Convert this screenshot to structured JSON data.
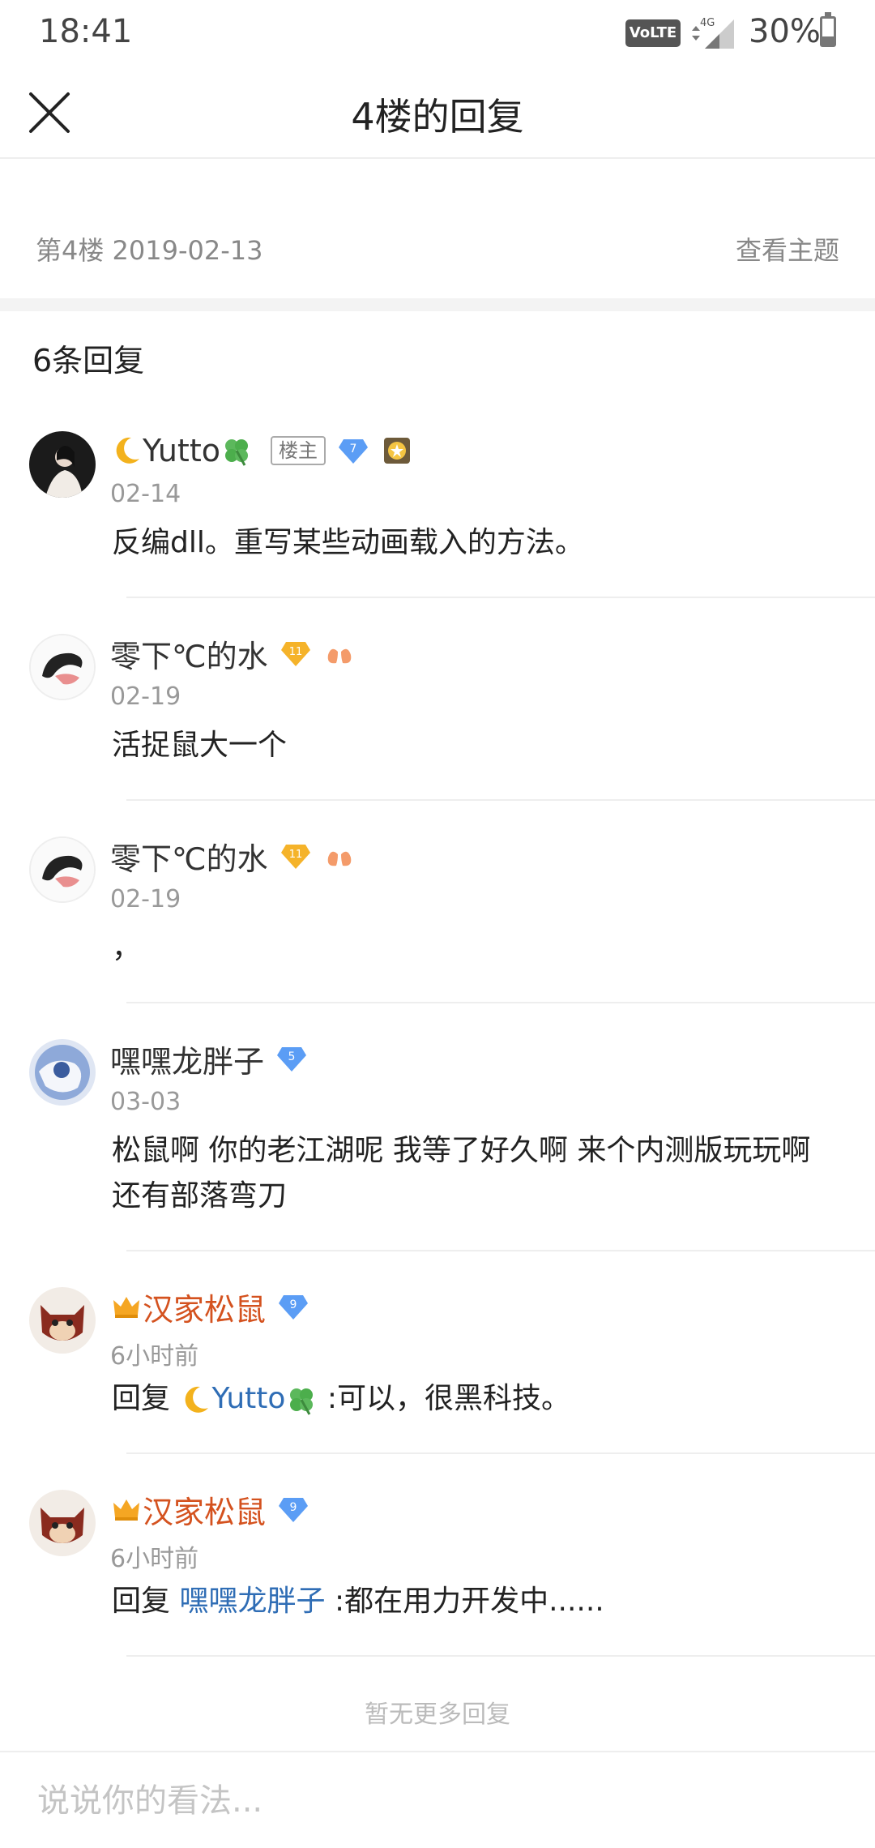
{
  "status_bar": {
    "time": "18:41",
    "network": "VoLTE",
    "signal_type": "4G",
    "battery_percent_text": "30%",
    "battery_level": 0.3
  },
  "header": {
    "title": "4楼的回复",
    "close_icon": "close-icon"
  },
  "floor": {
    "meta": "第4楼  2019-02-13",
    "view_topic": "查看主题"
  },
  "replies_count_label": "6条回复",
  "replies": [
    {
      "user": "Yutto",
      "owner_tag": "楼主",
      "level": "7",
      "date": "02-14",
      "content": "反编dll。重写某些动画载入的方法。"
    },
    {
      "user": "零下℃的水",
      "level": "11",
      "date": "02-19",
      "content": "活捉鼠大一个"
    },
    {
      "user": "零下℃的水",
      "level": "11",
      "date": "02-19",
      "content": "，"
    },
    {
      "user": "嘿嘿龙胖子",
      "level": "5",
      "date": "03-03",
      "content": "松鼠啊 你的老江湖呢 我等了好久啊 来个内测版玩玩啊 还有部落弯刀"
    },
    {
      "user": "汉家松鼠",
      "level": "9",
      "date": "6小时前",
      "reply_prefix": "回复",
      "reply_to": "Yutto",
      "content": ":可以，很黑科技。"
    },
    {
      "user": "汉家松鼠",
      "level": "9",
      "date": "6小时前",
      "reply_prefix": "回复",
      "reply_to": "嘿嘿龙胖子",
      "content": ":都在用力开发中......"
    }
  ],
  "no_more_text": "暂无更多回复",
  "comment_input": {
    "placeholder": "说说你的看法..."
  },
  "colors": {
    "accent_link": "#2f6db5",
    "author_red": "#d4521f",
    "level_blue": "#5b9df5",
    "level_gold": "#f5b32a"
  }
}
